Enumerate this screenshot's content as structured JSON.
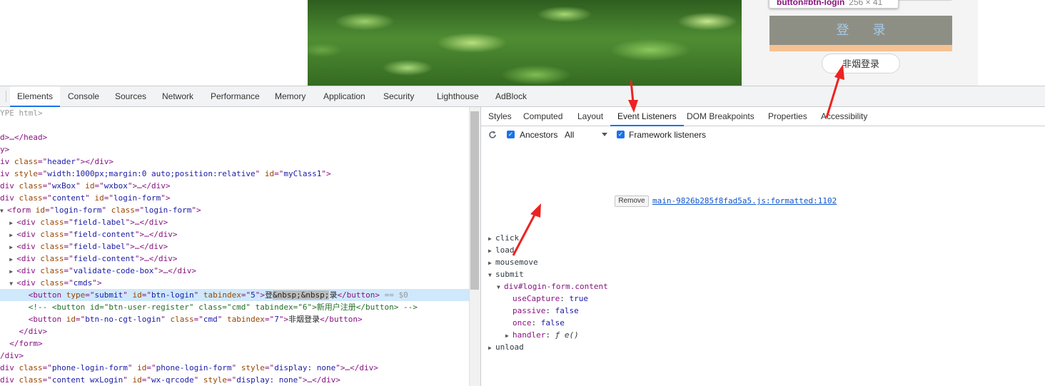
{
  "page": {
    "tooltip_selector": "button#btn-login",
    "tooltip_size": "256 × 41",
    "login_button_label": "登 录",
    "no_smoke_button_label": "非烟登录"
  },
  "devtools": {
    "main_tabs": [
      "Elements",
      "Console",
      "Sources",
      "Network",
      "Performance",
      "Memory",
      "Application",
      "Security",
      "Lighthouse",
      "AdBlock"
    ],
    "active_main_tab": "Elements",
    "sub_tabs": [
      "Styles",
      "Computed",
      "Layout",
      "Event Listeners",
      "DOM Breakpoints",
      "Properties",
      "Accessibility"
    ],
    "active_sub_tab": "Event Listeners",
    "toolbar": {
      "ancestors_label": "Ancestors",
      "ancestors_checked": true,
      "filter_value": "All",
      "framework_label": "Framework listeners",
      "framework_checked": true
    },
    "events": [
      "click",
      "load",
      "mousemove",
      "submit",
      "unload"
    ],
    "submit_listener": {
      "target": "div#login-form.content",
      "remove_label": "Remove",
      "source": "main-9826b285f8fad5a5.js:formatted:1102",
      "props": [
        {
          "key": "useCapture",
          "value": "true"
        },
        {
          "key": "passive",
          "value": "false"
        },
        {
          "key": "once",
          "value": "false"
        }
      ],
      "handler_key": "handler",
      "handler_value": "ƒ e()"
    }
  },
  "dom_tree": {
    "l0": "YPE html>",
    "l1_a": "d>…</",
    "l1_b": "head",
    "l1_c": ">",
    "l2": "y>",
    "header_div": {
      "tag": "iv",
      "attr": "class",
      "val": "header"
    },
    "myclass_div": {
      "tag": "iv",
      "attr1": "style",
      "val1": "width:1000px;margin:0 auto;position:relative",
      "attr2": "id",
      "val2": "myClass1"
    },
    "wxbox_div": {
      "attr1": "class",
      "val1": "wxBox",
      "attr2": "id",
      "val2": "wxbox"
    },
    "content_div": {
      "attr1": "class",
      "val1": "content",
      "attr2": "id",
      "val2": "login-form"
    },
    "form": {
      "attr1": "id",
      "val1": "login-form",
      "attr2": "class",
      "val2": "login-form"
    },
    "children": [
      {
        "val": "field-label"
      },
      {
        "val": "field-content"
      },
      {
        "val": "field-label"
      },
      {
        "val": "field-content"
      },
      {
        "val": "validate-code-box"
      }
    ],
    "cmds_div": {
      "val": "cmds"
    },
    "btn_login": {
      "type": "submit",
      "id": "btn-login",
      "tabindex": "5",
      "text_start": "登",
      "text_hl": "&nbsp;&nbsp;",
      "text_end": "录",
      "marker": "== $0"
    },
    "comment": "<!-- <button id=\"btn-user-register\" class=\"cmd\" tabindex=\"6\">新用户注册</button> -->",
    "btn_no_cgt": {
      "id": "btn-no-cgt-login",
      "class": "cmd",
      "tabindex": "7",
      "text": "非烟登录"
    },
    "close_div": "</div>",
    "close_form": "</form>",
    "close_div2": "/div>",
    "phone_div": {
      "attr1": "class",
      "val1": "phone-login-form",
      "attr2": "id",
      "val2": "phone-login-form",
      "attr3": "style",
      "val3": "display: none"
    },
    "wx_div": {
      "attr1": "class",
      "val1": "content wxLogin",
      "attr2": "id",
      "val2": "wx-qrcode",
      "attr3": "style",
      "val3": "display: none"
    }
  },
  "colors": {
    "annotation_arrow": "#ee2222",
    "active_tab_underline": "#1a73e8",
    "selected_row": "#cfe8fc",
    "login_button": "#8e8f84"
  }
}
